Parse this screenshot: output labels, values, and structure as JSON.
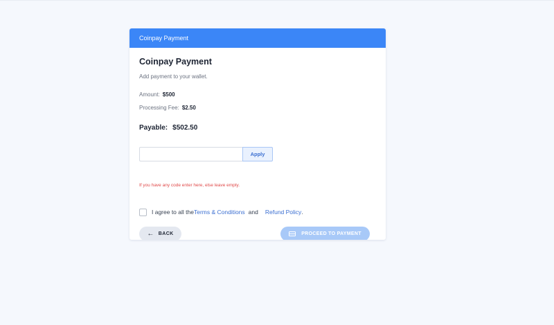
{
  "header": {
    "title": "Coinpay Payment"
  },
  "main": {
    "title": "Coinpay Payment",
    "subtitle": "Add payment to your wallet.",
    "amount_label": "Amount:",
    "amount_value": "$500",
    "fee_label": "Processing Fee:",
    "fee_value": "$2.50",
    "payable_label": "Payable:",
    "payable_value": "$502.50"
  },
  "code": {
    "value": "",
    "placeholder": "",
    "apply_label": "Apply",
    "hint": "If you have any code enter here, else leave empty."
  },
  "agreement": {
    "checked": false,
    "prefix": "I agree to all the",
    "terms_link": "Terms & Conditions",
    "and_text": "and",
    "refund_link": "Refund Policy",
    "suffix": "."
  },
  "actions": {
    "back_label": "BACK",
    "back_icon": "arrow-left-icon",
    "proceed_label": "PROCEED TO PAYMENT",
    "proceed_icon": "credit-card-icon"
  },
  "colors": {
    "header_bg": "#3b86f7",
    "link": "#3b6fd1",
    "hint": "#e04848",
    "proceed_bg": "#a8c9f8",
    "back_bg": "#e4e8f0",
    "page_bg": "#f5f8fd"
  }
}
